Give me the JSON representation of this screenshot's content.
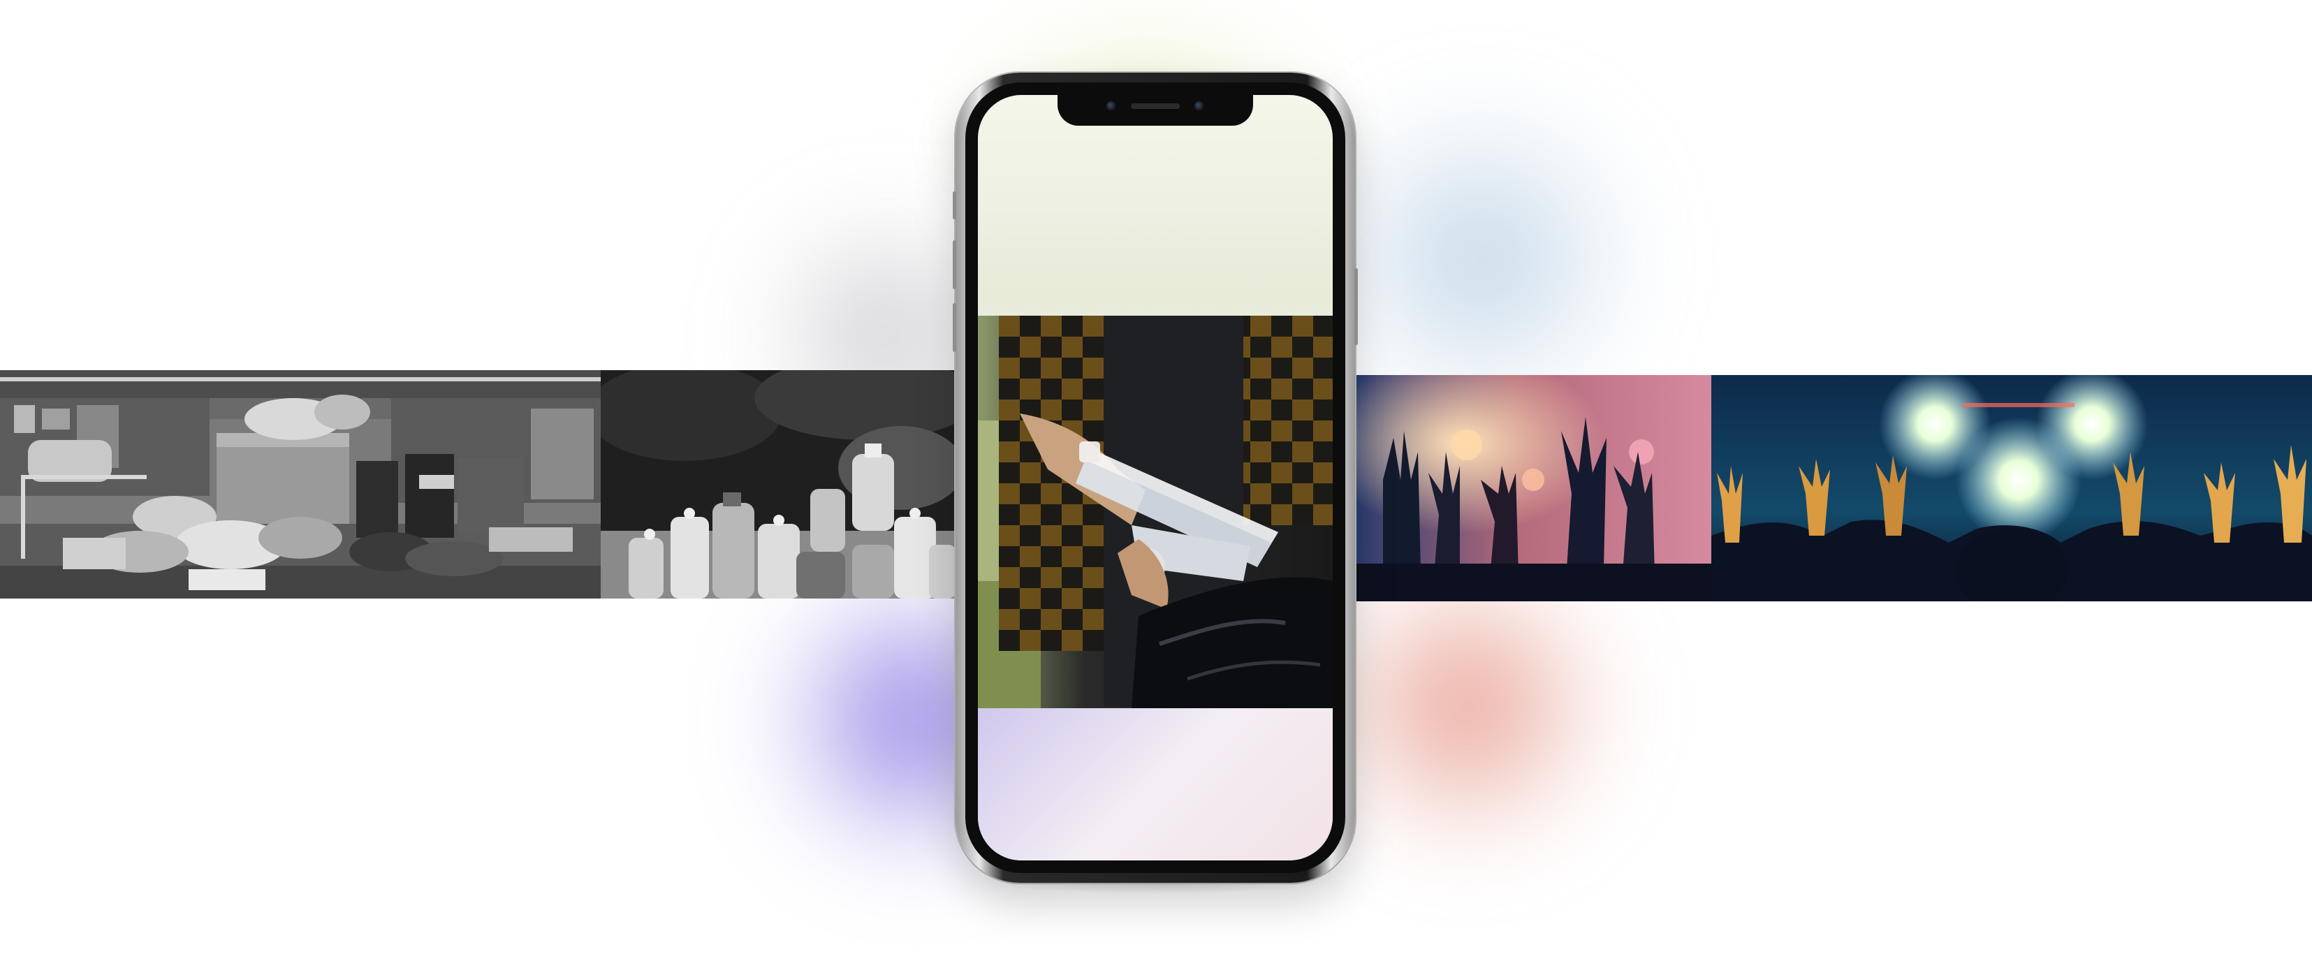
{
  "scene": {
    "photos": [
      {
        "name": "dumpster-photo",
        "description_icon": "trash-bins-photo"
      },
      {
        "name": "bottles-photo",
        "description_icon": "plastic-bottles-photo"
      },
      {
        "name": "crowd-hands-photo",
        "description_icon": "raised-hands-photo"
      },
      {
        "name": "concert-photo",
        "description_icon": "concert-crowd-photo"
      }
    ],
    "phone": {
      "screen_photo": "hand-holding-plastic-bottles-photo"
    },
    "colors": {
      "glow_top": "#d6e296",
      "glow_purple": "#6e5adc",
      "glow_red": "#de7864",
      "glow_blue": "#96b9d7",
      "phone_frame": "#1a1a1a"
    }
  }
}
